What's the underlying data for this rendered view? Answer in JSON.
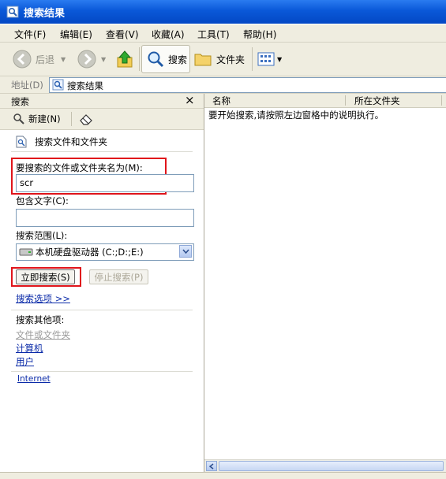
{
  "window": {
    "title": "搜索结果"
  },
  "menu": {
    "items": [
      "文件(F)",
      "编辑(E)",
      "查看(V)",
      "收藏(A)",
      "工具(T)",
      "帮助(H)"
    ]
  },
  "toolbar": {
    "back_label": "后退",
    "search_label": "搜索",
    "folders_label": "文件夹"
  },
  "address": {
    "label": "地址(D)",
    "value": "搜索结果"
  },
  "search_pane": {
    "header": "搜索",
    "close_glyph": "×",
    "new_label": "新建(N)",
    "title": "搜索文件和文件夹",
    "filename_label": "要搜索的文件或文件夹名为(M):",
    "filename_value": "scr",
    "text_label": "包含文字(C):",
    "text_value": "",
    "scope_label": "搜索范围(L):",
    "scope_value": "本机硬盘驱动器 (C:;D:;E:)",
    "search_now": "立即搜索(S)",
    "stop_search": "停止搜索(P)",
    "options": "搜索选项 >>",
    "other_header": "搜索其他项:",
    "other_items": [
      "文件或文件夹",
      "计算机",
      "用户"
    ],
    "internet": "Internet"
  },
  "results": {
    "col_name": "名称",
    "col_folder": "所在文件夹",
    "message": "要开始搜索,请按照左边窗格中的说明执行。"
  },
  "colors": {
    "titlebar": "#0a58d8",
    "highlight_box": "#e0141a",
    "link": "#0a2aa8"
  }
}
